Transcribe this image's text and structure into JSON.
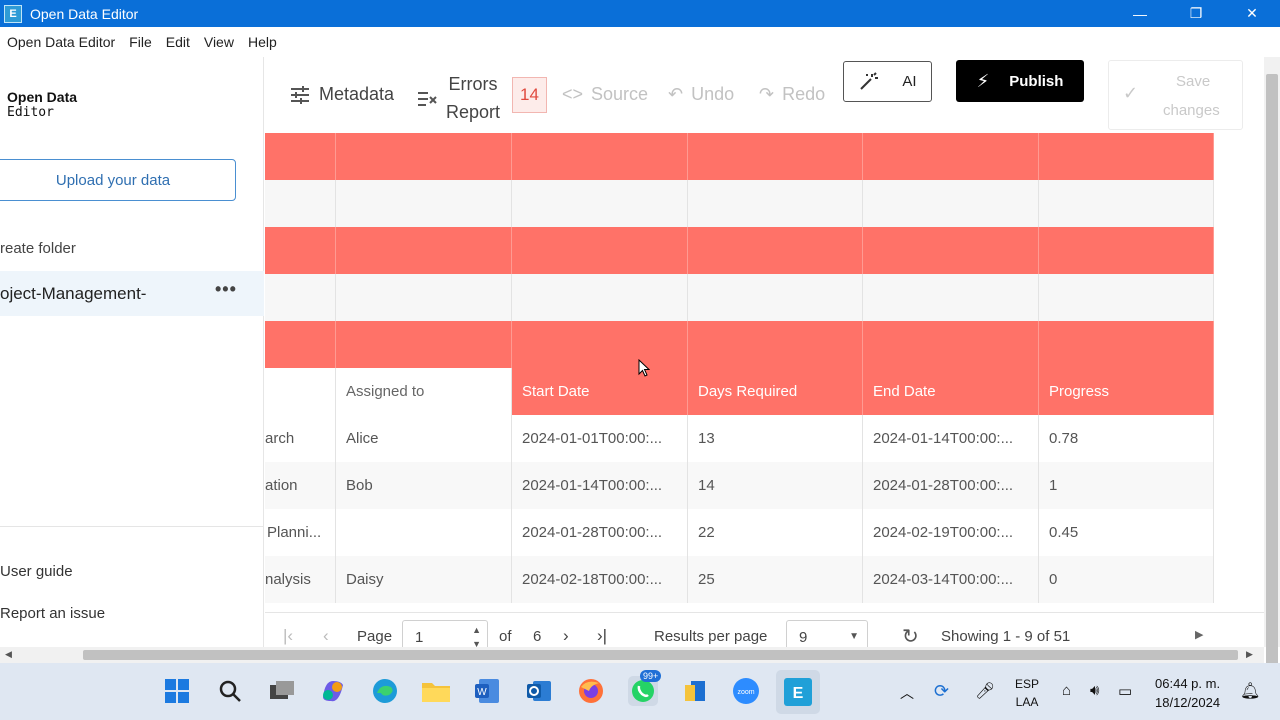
{
  "window": {
    "title": "Open Data Editor",
    "app_icon_glyph": "E",
    "controls": {
      "minimize": "—",
      "maximize": "❐",
      "close": "✕"
    }
  },
  "menu": [
    "Open Data Editor",
    "File",
    "Edit",
    "View",
    "Help"
  ],
  "sidebar": {
    "app_name_line1": "Open Data",
    "app_name_line2": "Editor",
    "upload_label": "Upload your data",
    "create_folder": "reate folder",
    "project_name": "oject-Management-",
    "project_more": "•••",
    "user_guide": "User guide",
    "report_issue": "Report an issue"
  },
  "toolbar": {
    "metadata": "Metadata",
    "errors_line1": "Errors",
    "errors_line2": "Report",
    "errors_count": "14",
    "source": "Source",
    "undo": "Undo",
    "redo": "Redo",
    "ai": "AI",
    "publish": "Publish",
    "save_line1": "Save",
    "save_line2": "changes"
  },
  "grid": {
    "headers": [
      "",
      "Assigned to",
      "Start Date",
      "Days Required",
      "End Date",
      "Progress"
    ],
    "rows": [
      [
        "arch",
        "Alice",
        "2024-01-01T00:00:...",
        "13",
        "2024-01-14T00:00:...",
        "0.78"
      ],
      [
        "ation",
        "Bob",
        "2024-01-14T00:00:...",
        "14",
        "2024-01-28T00:00:...",
        "1"
      ],
      [
        "Planni...",
        "",
        "2024-01-28T00:00:...",
        "22",
        "2024-02-19T00:00:...",
        "0.45"
      ],
      [
        "nalysis",
        "Daisy",
        "2024-02-18T00:00:...",
        "25",
        "2024-03-14T00:00:...",
        "0"
      ]
    ]
  },
  "pager": {
    "page_label": "Page",
    "page_value": "1",
    "of_label": "of",
    "total_pages": "6",
    "results_label": "Results per page",
    "results_value": "9",
    "showing": "Showing 1 - 9 of 51"
  },
  "taskbar": {
    "whatsapp_badge": "99+",
    "zoom_label": "zoom",
    "lang_line1": "ESP",
    "lang_line2": "LAA",
    "time": "06:44 p. m.",
    "date": "18/12/2024"
  },
  "colors": {
    "accent": "#0a6fd8",
    "error_row": "#ff7268",
    "publish": "#000000"
  }
}
